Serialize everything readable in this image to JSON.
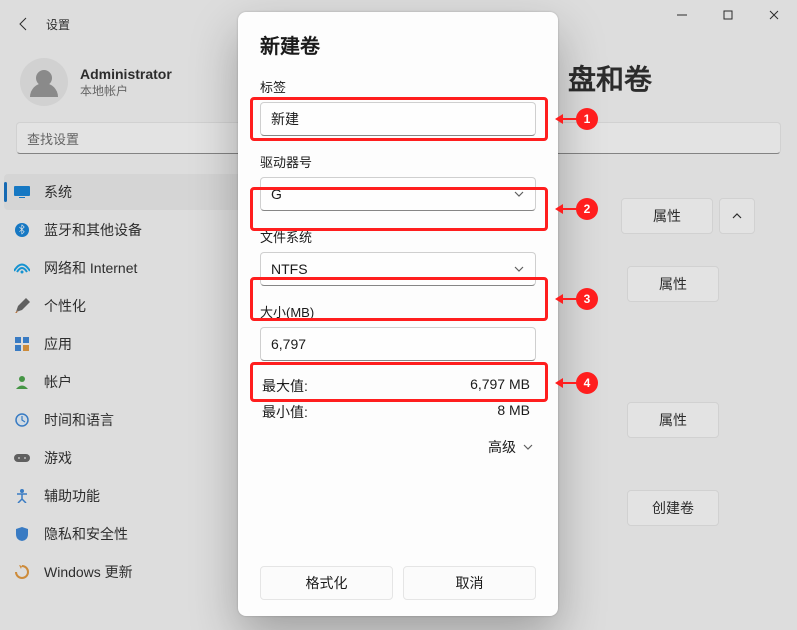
{
  "header": {
    "title": "设置"
  },
  "window_controls": {
    "min": "min",
    "max": "max",
    "close": "close"
  },
  "user": {
    "name": "Administrator",
    "sub": "本地帐户"
  },
  "search": {
    "placeholder": "查找设置"
  },
  "sidebar": {
    "items": [
      {
        "label": "系统",
        "icon": "system-icon"
      },
      {
        "label": "蓝牙和其他设备",
        "icon": "bluetooth-icon"
      },
      {
        "label": "网络和 Internet",
        "icon": "network-icon"
      },
      {
        "label": "个性化",
        "icon": "personalization-icon"
      },
      {
        "label": "应用",
        "icon": "apps-icon"
      },
      {
        "label": "帐户",
        "icon": "accounts-icon"
      },
      {
        "label": "时间和语言",
        "icon": "time-icon"
      },
      {
        "label": "游戏",
        "icon": "gaming-icon"
      },
      {
        "label": "辅助功能",
        "icon": "accessibility-icon"
      },
      {
        "label": "隐私和安全性",
        "icon": "privacy-icon"
      },
      {
        "label": "Windows 更新",
        "icon": "update-icon"
      }
    ]
  },
  "page": {
    "title_fragment": "盘和卷",
    "buttons": {
      "props": "属性",
      "create": "创建卷"
    }
  },
  "modal": {
    "title": "新建卷",
    "label_field": {
      "label": "标签",
      "value": "新建"
    },
    "letter_field": {
      "label": "驱动器号",
      "value": "G"
    },
    "fs_field": {
      "label": "文件系统",
      "value": "NTFS"
    },
    "size_field": {
      "label": "大小(MB)",
      "value": "6,797"
    },
    "limits": {
      "max_key": "最大值:",
      "max_val": "6,797 MB",
      "min_key": "最小值:",
      "min_val": "8 MB"
    },
    "advanced": "高级",
    "format_btn": "格式化",
    "cancel_btn": "取消"
  },
  "annotations": {
    "n1": "1",
    "n2": "2",
    "n3": "3",
    "n4": "4"
  },
  "colors": {
    "accent": "#0067c0",
    "annotation": "#ff1e1e"
  }
}
